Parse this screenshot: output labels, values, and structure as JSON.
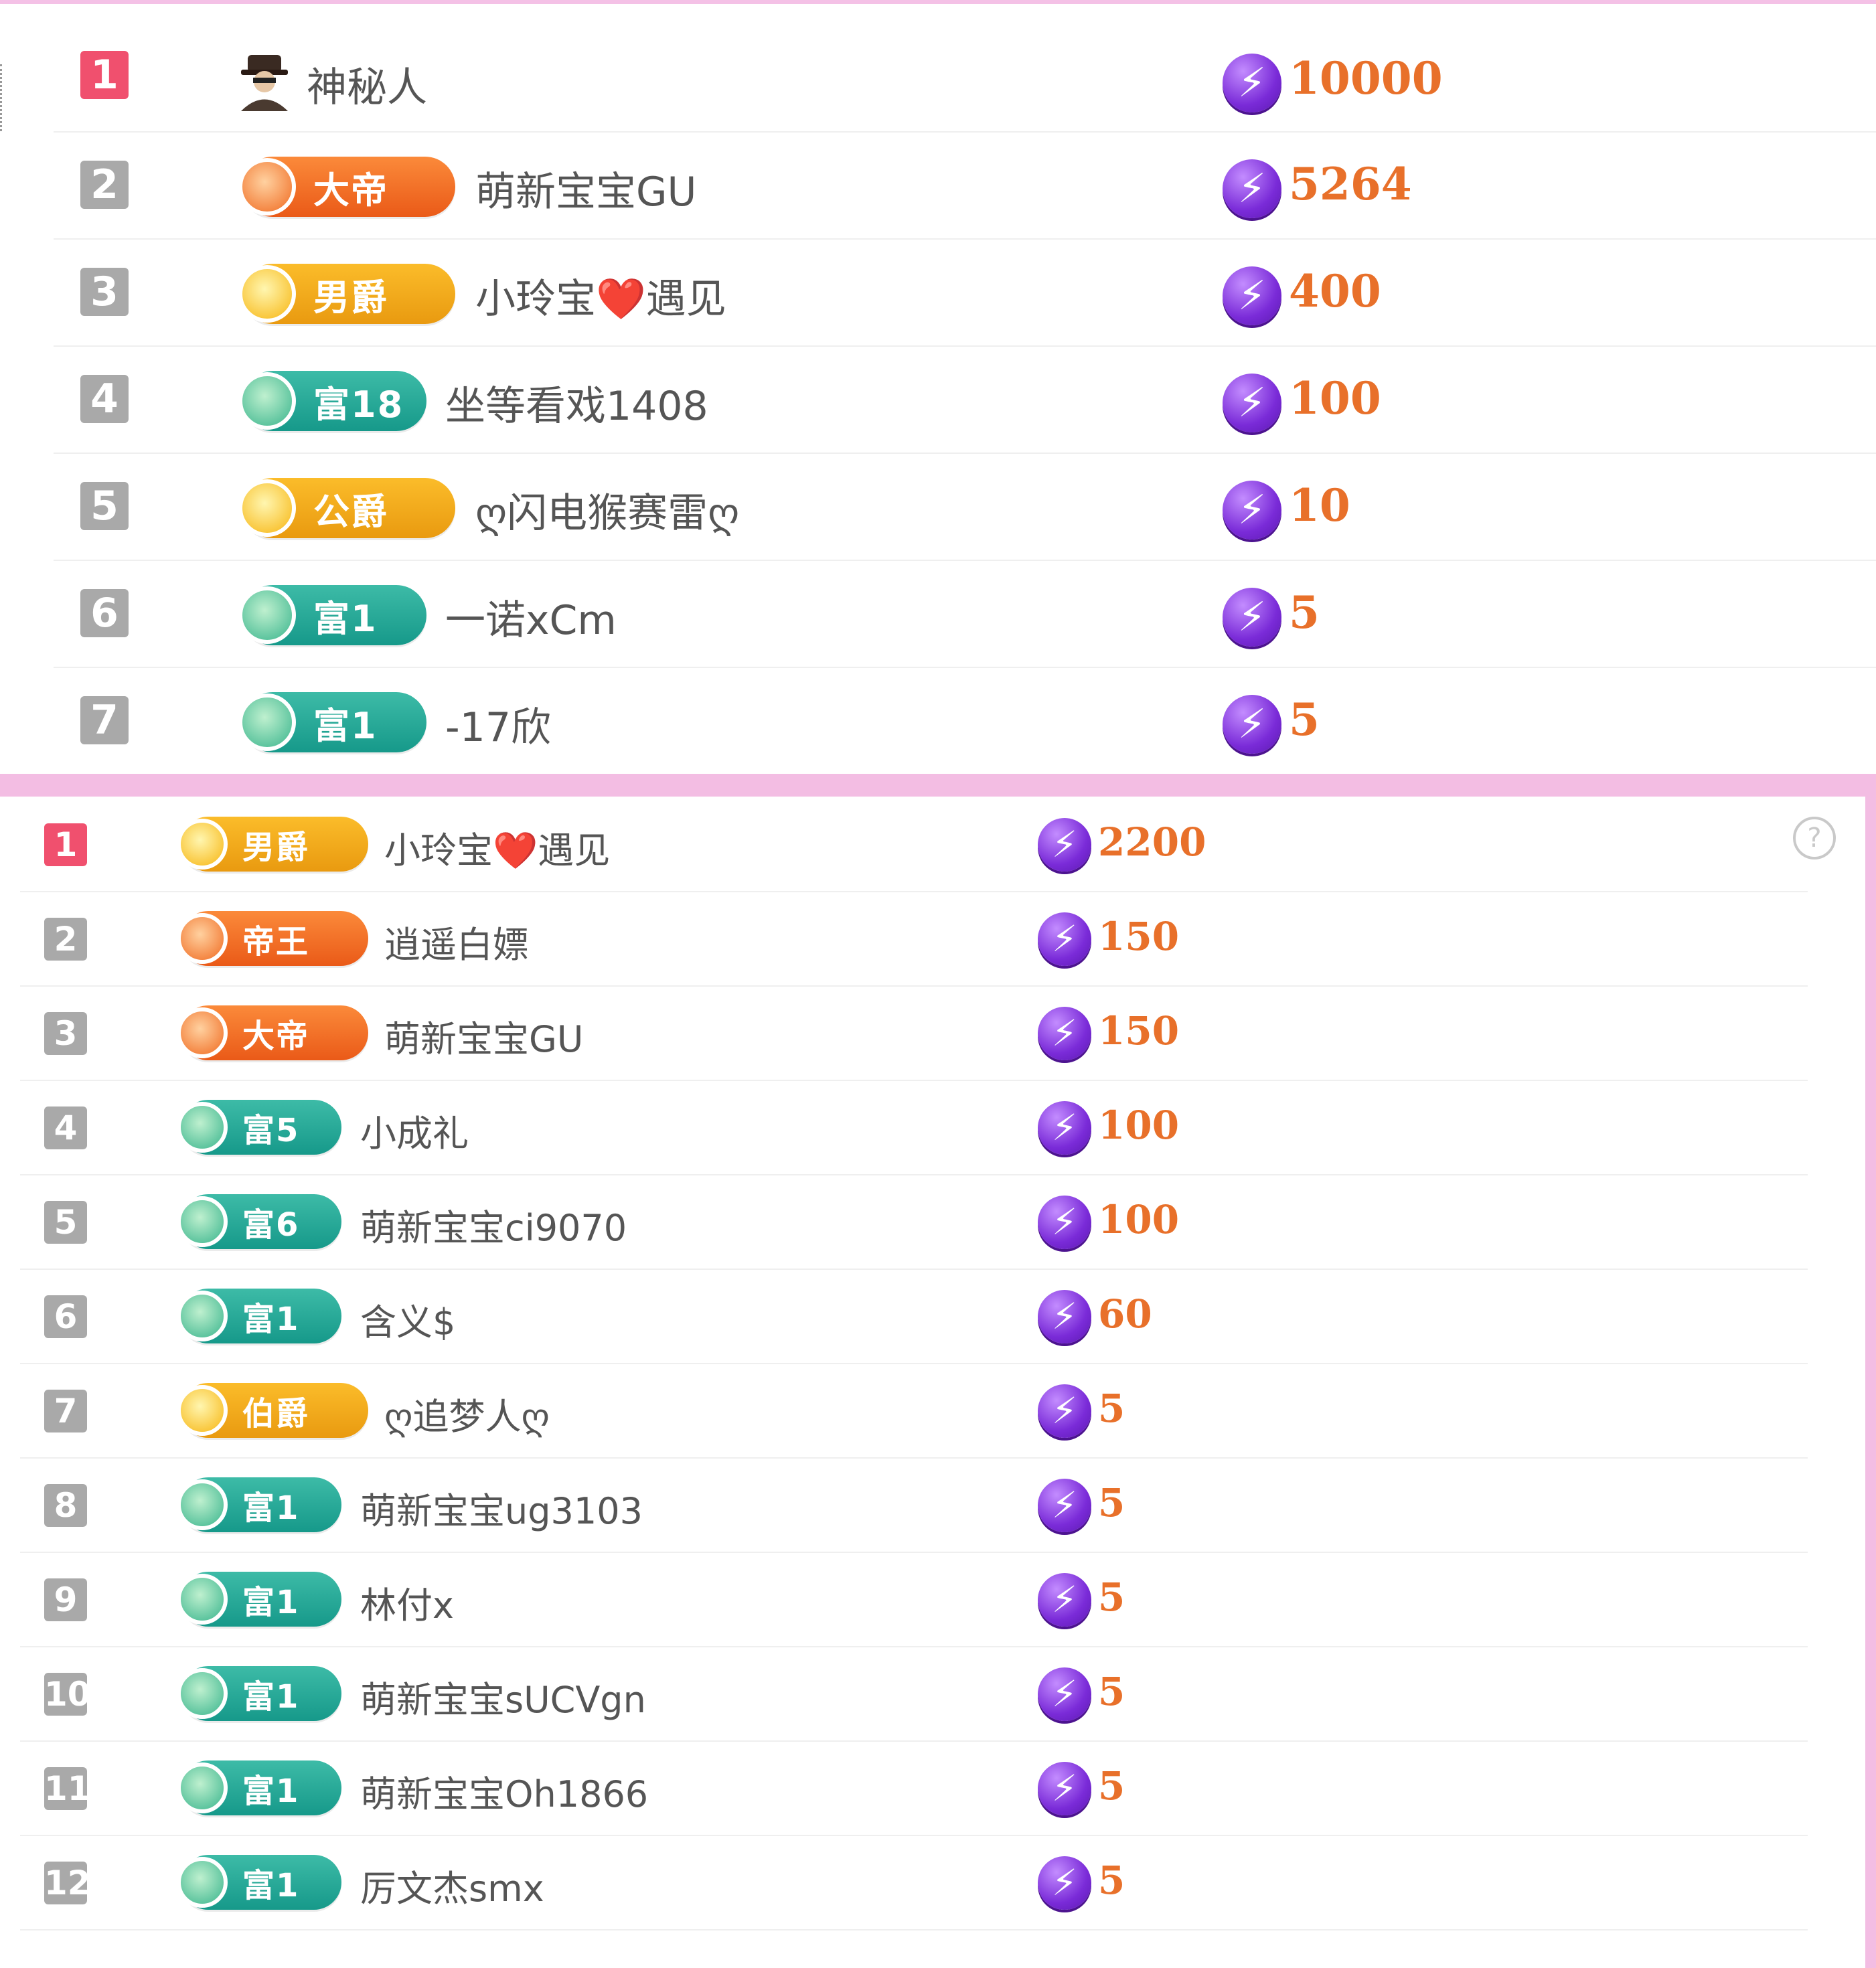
{
  "top_board": {
    "rows": [
      {
        "rank": "1",
        "badge": null,
        "avatar": "mysterious-person-icon",
        "name": "神秘人",
        "score": "10000"
      },
      {
        "rank": "2",
        "badge": {
          "label": "大帝",
          "tier": "orange"
        },
        "name": "萌新宝宝GU",
        "score": "5264"
      },
      {
        "rank": "3",
        "badge": {
          "label": "男爵",
          "tier": "gold"
        },
        "name": "小玲宝❤️遇见",
        "score": "400"
      },
      {
        "rank": "4",
        "badge": {
          "label": "富18",
          "tier": "green"
        },
        "name": "坐等看戏1408",
        "score": "100"
      },
      {
        "rank": "5",
        "badge": {
          "label": "公爵",
          "tier": "gold"
        },
        "name": "ღ闪电猴赛雷ღ",
        "score": "10"
      },
      {
        "rank": "6",
        "badge": {
          "label": "富1",
          "tier": "green"
        },
        "name": "一诺xCm",
        "score": "5"
      },
      {
        "rank": "7",
        "badge": {
          "label": "富1",
          "tier": "green"
        },
        "name": "-17欣",
        "score": "5"
      }
    ]
  },
  "bottom_board": {
    "help_icon": "question-icon",
    "rows": [
      {
        "rank": "1",
        "badge": {
          "label": "男爵",
          "tier": "gold"
        },
        "name": "小玲宝❤️遇见",
        "score": "2200"
      },
      {
        "rank": "2",
        "badge": {
          "label": "帝王",
          "tier": "orange"
        },
        "name": "逍遥白嫖",
        "score": "150"
      },
      {
        "rank": "3",
        "badge": {
          "label": "大帝",
          "tier": "orange"
        },
        "name": "萌新宝宝GU",
        "score": "150"
      },
      {
        "rank": "4",
        "badge": {
          "label": "富5",
          "tier": "green"
        },
        "name": "小成礼",
        "score": "100"
      },
      {
        "rank": "5",
        "badge": {
          "label": "富6",
          "tier": "green"
        },
        "name": "萌新宝宝ci9070",
        "score": "100"
      },
      {
        "rank": "6",
        "badge": {
          "label": "富1",
          "tier": "green"
        },
        "name": "含义$",
        "score": "60"
      },
      {
        "rank": "7",
        "badge": {
          "label": "伯爵",
          "tier": "gold"
        },
        "name": "ღ追梦人ღ",
        "score": "5"
      },
      {
        "rank": "8",
        "badge": {
          "label": "富1",
          "tier": "green"
        },
        "name": "萌新宝宝ug3103",
        "score": "5"
      },
      {
        "rank": "9",
        "badge": {
          "label": "富1",
          "tier": "green"
        },
        "name": "林付x",
        "score": "5"
      },
      {
        "rank": "10",
        "badge": {
          "label": "富1",
          "tier": "green"
        },
        "name": "萌新宝宝sUCVgn",
        "score": "5"
      },
      {
        "rank": "11",
        "badge": {
          "label": "富1",
          "tier": "green"
        },
        "name": "萌新宝宝Oh1866",
        "score": "5"
      },
      {
        "rank": "12",
        "badge": {
          "label": "富1",
          "tier": "green"
        },
        "name": "厉文杰smx",
        "score": "5"
      }
    ]
  },
  "colors": {
    "accent_pink": "#f3bde3",
    "rank_first": "#f0506e",
    "rank_other": "#a9a9a9",
    "score_orange": "#e8702a",
    "coin_purple": "#7a2bd8"
  }
}
